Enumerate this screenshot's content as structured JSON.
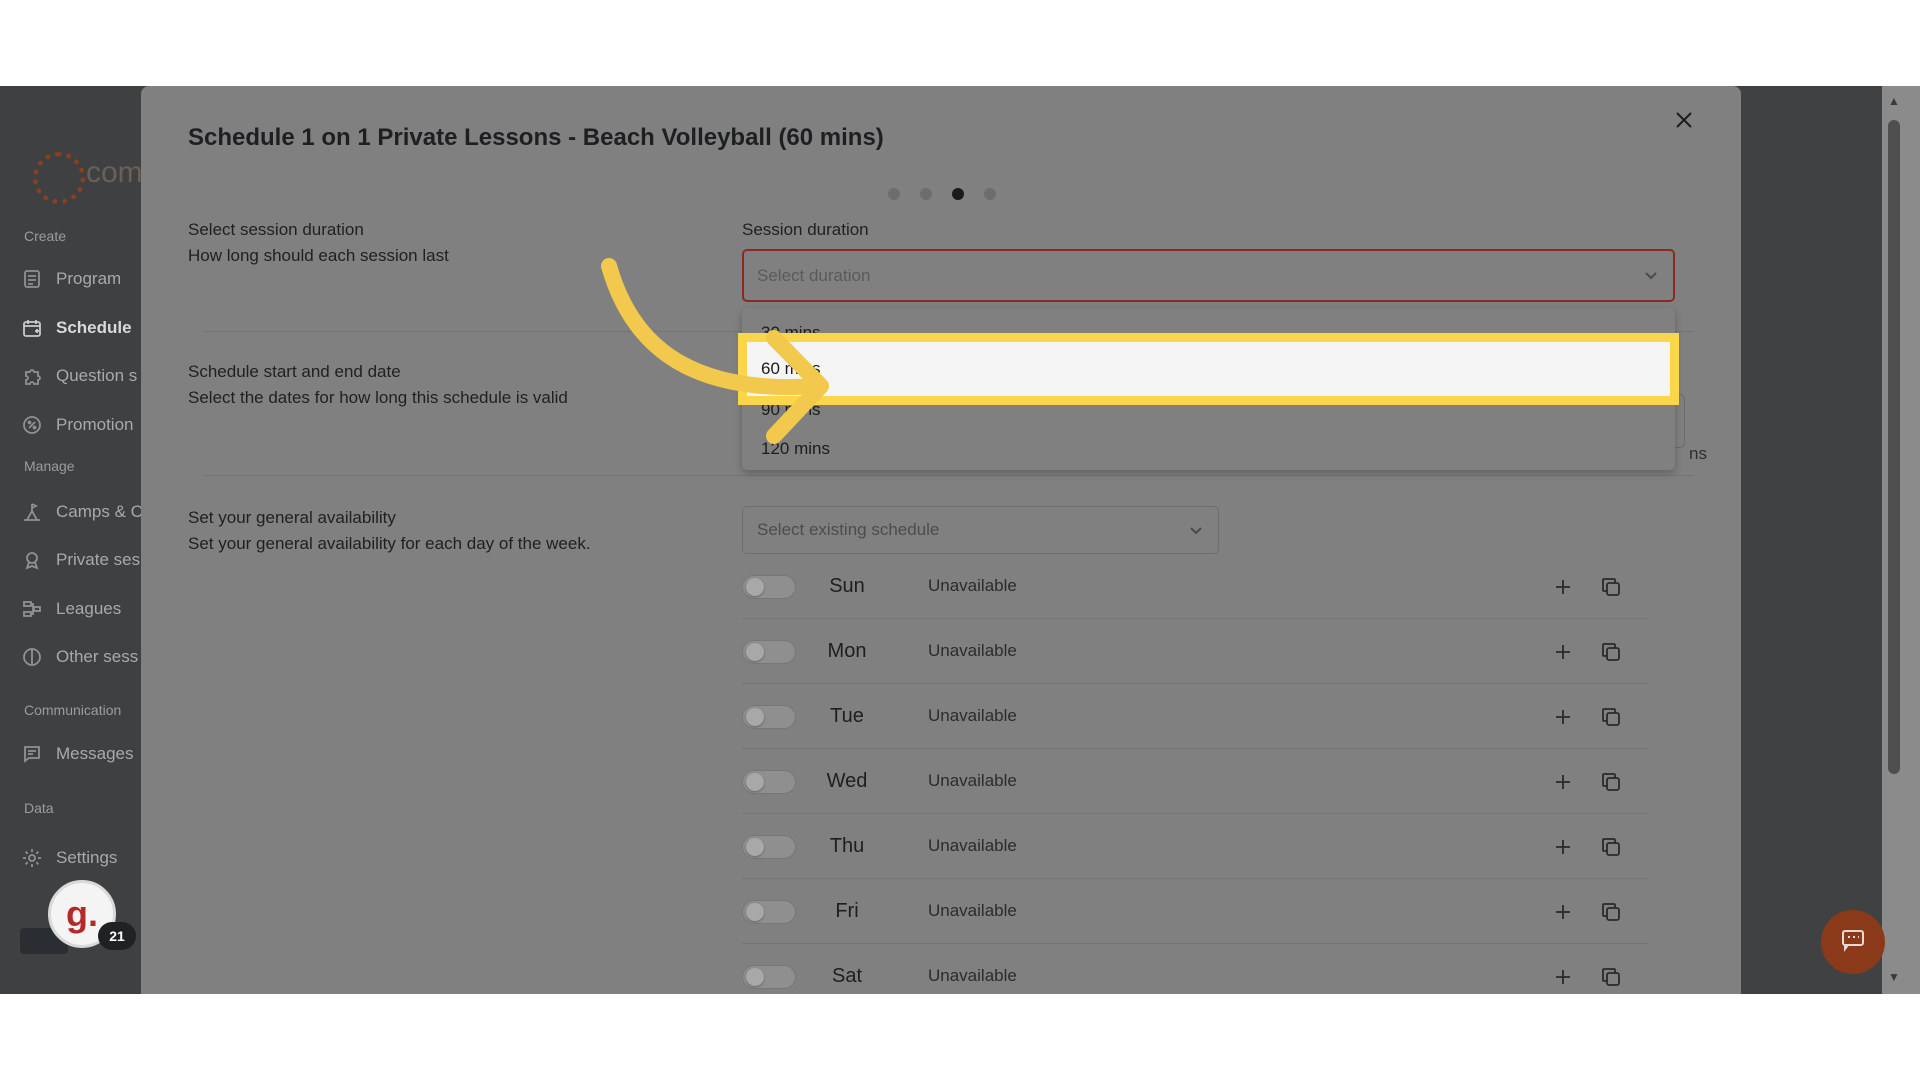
{
  "sidebar": {
    "logo_text": "com",
    "sections": {
      "create": "Create",
      "manage": "Manage",
      "communication": "Communication",
      "data": "Data"
    },
    "items": [
      {
        "label": "Program",
        "icon": "program-icon"
      },
      {
        "label": "Schedule",
        "icon": "calendar-icon",
        "active": true
      },
      {
        "label": "Question s",
        "icon": "puzzle-icon"
      },
      {
        "label": "Promotion",
        "icon": "percent-icon"
      },
      {
        "label": "Camps & C",
        "icon": "camp-icon"
      },
      {
        "label": "Private ses",
        "icon": "award-icon"
      },
      {
        "label": "Leagues",
        "icon": "bracket-icon"
      },
      {
        "label": "Other sess",
        "icon": "circle-half-icon"
      },
      {
        "label": "Messages",
        "icon": "message-icon"
      },
      {
        "label": "Settings",
        "icon": "gear-icon"
      }
    ],
    "avatar_letter": "g.",
    "notification_count": "21"
  },
  "modal": {
    "title": "Schedule 1 on 1 Private Lessons - Beach Volleyball (60 mins)",
    "step_total": 4,
    "step_current": 3,
    "duration_section": {
      "title": "Select session duration",
      "subtitle": "How long should each session last"
    },
    "date_section": {
      "title": "Schedule start and end date",
      "subtitle": "Select the dates for how long this schedule is valid"
    },
    "availability_section": {
      "title": "Set your general availability",
      "subtitle": "Set your general availability for each day of the week."
    },
    "duration_field": {
      "label": "Session duration",
      "placeholder": "Select duration",
      "options": [
        "30 mins",
        "60 mins",
        "90 mins",
        "120 mins"
      ],
      "highlighted": "60 mins"
    },
    "partial_text": "ns",
    "existing_schedule_placeholder": "Select existing schedule",
    "days": [
      {
        "name": "Sun",
        "status": "Unavailable"
      },
      {
        "name": "Mon",
        "status": "Unavailable"
      },
      {
        "name": "Tue",
        "status": "Unavailable"
      },
      {
        "name": "Wed",
        "status": "Unavailable"
      },
      {
        "name": "Thu",
        "status": "Unavailable"
      },
      {
        "name": "Fri",
        "status": "Unavailable"
      },
      {
        "name": "Sat",
        "status": "Unavailable"
      }
    ]
  },
  "colors": {
    "highlight": "#fbd54a",
    "overlay": "#808080",
    "error_border": "#8c2a20",
    "chat_button": "#8a3a18"
  }
}
